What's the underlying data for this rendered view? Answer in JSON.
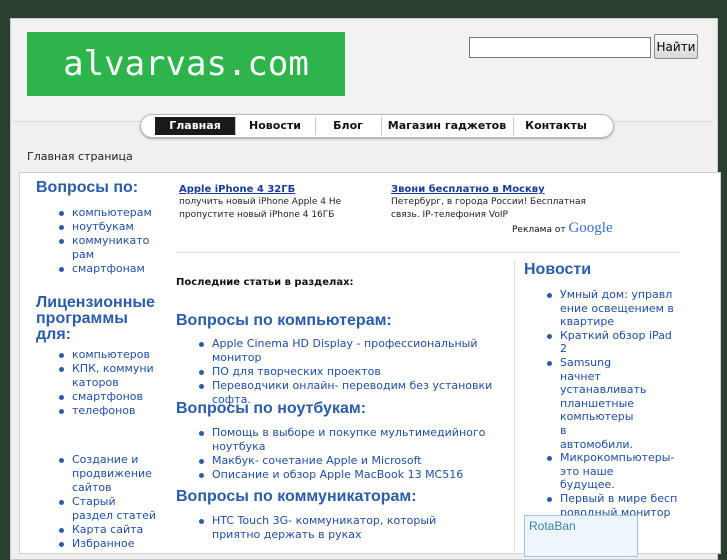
{
  "site": {
    "logo_text": "alvarvas.com"
  },
  "search": {
    "placeholder": "",
    "button_label": "Найти"
  },
  "nav": {
    "items": [
      "Главная",
      "Новости",
      "Блог",
      "Магазин гаджетов",
      "Контакты"
    ],
    "active": "Главная"
  },
  "breadcrumb": "Главная страница",
  "sidebar": {
    "heading1": "Вопросы по:",
    "list1": [
      "компьютерам",
      "ноутбукам",
      "коммуникаторам",
      "смартфонам"
    ],
    "heading2": "Лицензионные программы для:",
    "list2": [
      "компьютеров",
      "КПК, коммуникаторов",
      "смартфонов",
      "телефонов"
    ],
    "list3": [
      "Создание и продвижение сайтов",
      "Старый раздел статей",
      "Карта сайта",
      "Избранное"
    ]
  },
  "ads": [
    {
      "title": "Apple iPhone 4 32ГБ",
      "text": "получить новый iPhone Apple 4 Не пропустите новый iPhone 4 16ГБ"
    },
    {
      "title": "Звони бесплатно в Москву",
      "text": "Петербург, в города России! Бесплатная связь. IP-телефония VoIP"
    }
  ],
  "ads_by": {
    "prefix": "Реклама от",
    "brand": "Google"
  },
  "main": {
    "latest_label": "Последние статьи в разделах:",
    "sections": [
      {
        "heading": "Вопросы по компьютерам:",
        "items": [
          "Apple Cinema HD Display - профессиональный монитор",
          "ПО для творческих проектов",
          "Переводчики онлайн- переводим без установки софта."
        ]
      },
      {
        "heading": "Вопросы по ноутбукам:",
        "items": [
          "Помощь в выборе и покупке мультимедийного ноутбука",
          "Макбук- сочетание Apple и Microsoft",
          "Описание и обзор Apple MacBook 13 MC516"
        ]
      },
      {
        "heading": "Вопросы по коммуникаторам:",
        "items": [
          "HTC Touch 3G- коммуникатор, который приятно держать в руках"
        ]
      }
    ]
  },
  "news": {
    "heading": "Новости",
    "items": [
      "Умный дом: управление освещением в квартире",
      "Краткий обзор iPad 2",
      "Samsung начнет устанавливать планшетные компьютеры в автомобили.",
      "Микрокомпьютеры- это наше будущее.",
      "Первый в мире беспроводный монитор"
    ]
  },
  "banner_text": "RotaBan",
  "colors": {
    "background": "#2a3f2e",
    "logo_bg": "#2db44a",
    "heading": "#2a5caa",
    "link": "#1f4fa8",
    "nav_active": "#1a1a1a"
  }
}
